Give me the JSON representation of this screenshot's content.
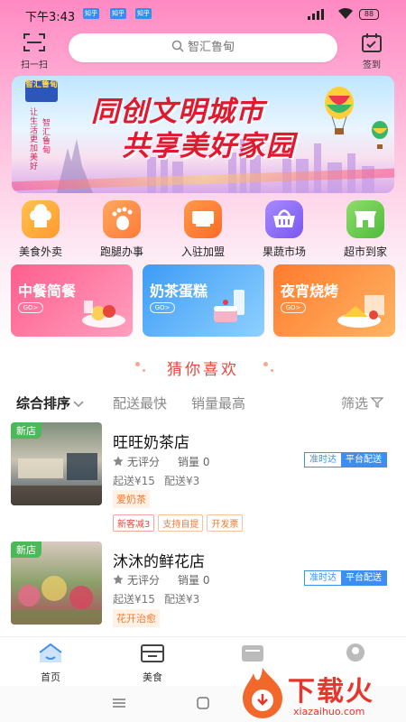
{
  "status": {
    "time": "下午3:43",
    "notif_badges": [
      "知乎",
      "知乎"
    ],
    "signal": "4G",
    "battery": "88"
  },
  "header": {
    "scan_label": "扫一扫",
    "search_placeholder": "智汇鲁甸",
    "checkin_label": "签到"
  },
  "banner": {
    "badge": "智汇鲁甸",
    "side_text_1": "让生活更加美好",
    "side_text_2": "智汇鲁甸",
    "line1": "同创文明城市",
    "line2": "共享美好家园"
  },
  "categories": [
    {
      "label": "美食外卖",
      "icon": "chef-hat-icon",
      "color": "#ffa43a"
    },
    {
      "label": "跑腿办事",
      "icon": "footprint-icon",
      "color": "#ff8c4b"
    },
    {
      "label": "入驻加盟",
      "icon": "shop-sign-icon",
      "color": "#ff7a30"
    },
    {
      "label": "果蔬市场",
      "icon": "basket-icon",
      "color": "#8d6bf5"
    },
    {
      "label": "超市到家",
      "icon": "store-icon",
      "color": "#67c94f"
    }
  ],
  "promos": [
    {
      "title": "中餐简餐",
      "go": "GO>",
      "color1": "#ff5e8e",
      "color2": "#ff9fbf"
    },
    {
      "title": "奶茶蛋糕",
      "go": "GO>",
      "color1": "#3d9cf5",
      "color2": "#8ed0ff"
    },
    {
      "title": "夜宵烧烤",
      "go": "GO>",
      "color1": "#ff7b2e",
      "color2": "#ffb463"
    }
  ],
  "guess": {
    "title": "猜你喜欢"
  },
  "sort": {
    "items": [
      "综合排序",
      "配送最快",
      "销量最高"
    ],
    "filter": "筛选"
  },
  "stores": [
    {
      "name": "旺旺奶茶店",
      "new_tag": "新店",
      "rating": "无评分",
      "sales": "销量 0",
      "min_order": "起送¥15",
      "delivery_fee": "配送¥3",
      "category": "爱奶茶",
      "tags": [
        "新客减3",
        "支持自提",
        "开发票"
      ],
      "ontime": "准时达",
      "platform": "平台配送"
    },
    {
      "name": "沐沐的鲜花店",
      "new_tag": "新店",
      "rating": "无评分",
      "sales": "销量 0",
      "min_order": "起送¥15",
      "delivery_fee": "配送¥3",
      "category": "花开治愈",
      "tags": [],
      "ontime": "准时达",
      "platform": "平台配送"
    }
  ],
  "bottom_nav": [
    {
      "label": "首页",
      "active": true
    },
    {
      "label": "美食",
      "active": false
    },
    {
      "label": "",
      "active": false
    },
    {
      "label": "",
      "active": false
    }
  ],
  "watermark": {
    "title": "下载火",
    "url": "xiazaihuo.com"
  }
}
